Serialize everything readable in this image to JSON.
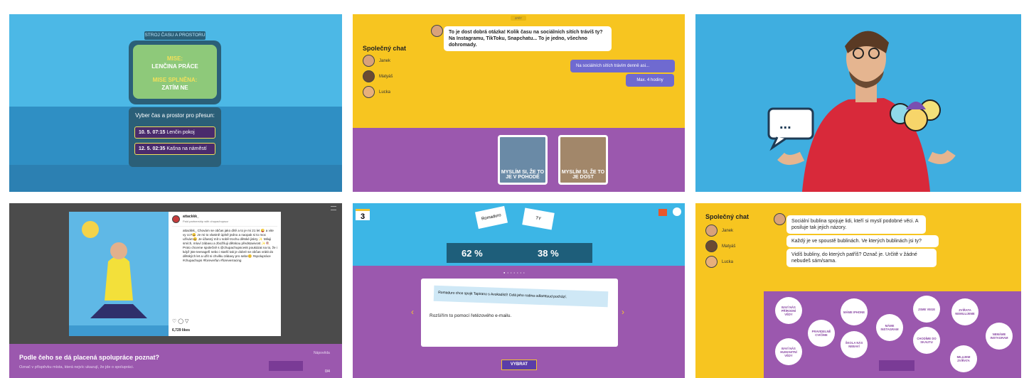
{
  "panel1": {
    "sign": "STROJ ČASU A PROSTORU",
    "mission_label": "MISE:",
    "mission_value": "LENČINA PRÁCE",
    "done_label": "MISE SPLNĚNA:",
    "done_value": "ZATÍM NE",
    "prompt": "Vyber čas a prostor pro přesun:",
    "options": [
      {
        "time": "10. 5. 07:15",
        "place": "Lenčin pokoj"
      },
      {
        "time": "12. 5. 02:35",
        "place": "Kašna na náměstí"
      }
    ]
  },
  "panel2": {
    "sidebar_title": "Společný chat",
    "people": [
      "Janek",
      "Matyáš",
      "Lucka"
    ],
    "question": "To je dost dobrá otázka! Kolik času na sociálních sítích trávíš ty? Na Instagramu, TikToku, Snapchatu... To je jedno, všechno dohromady.",
    "answer1": "Na sociálních sítích trávím denně asi...",
    "answer2": "Max. 4 hodiny",
    "meme1": "MYSLÍM SI, ŽE TO JE V POHODĚ",
    "meme2": "MYSLÍM SI, ŽE TO JE DOST",
    "top_tag": "ZPĚT"
  },
  "panel3": {
    "speech_dots": "..."
  },
  "panel4": {
    "username": "attackkk_",
    "subline": "Paid partnership with chupachupscz",
    "caption": "attackkk_ Chovám se občas jako dítě a to je mi 21 let 😜 a vite vy co?😀 Je mi to vlastně úplně jedno a naopak si to moc užívám😄 Je úžasný mít v sobě trochu dětské jiskry ✨ Miluji smích, mluví zábavu a zbožňuji dětskou představivost ✨🍭 Proto chceme společně s @chupachupscesk poukázat na to, že i když jste teenageři nebo i starší tak je dobré se občas vrátit do dětských let a užít si chvilku zábavy pro sebe😊 #spolupráce #chupachups #foreverfun #foreverracing",
    "likes": "6,729 likes",
    "title": "Podle čeho se dá placená spolupráce poznat?",
    "subtitle": "Označ v příspěvku místa, která nejvíc ukazují, že jde o spolupráci.",
    "help": "Nápověda",
    "counter": "0/4"
  },
  "panel5": {
    "level": "3",
    "card_left": "Romaduro",
    "card_right": "TY",
    "pct_left": "62 %",
    "pct_right": "38 %",
    "highlight": "Romaduro chce spojit Tapirano s Avokadistí! Celá jeho rodina odlamtuud pochází.",
    "answer": "Rozšířím to pomocí řetězového e-mailu.",
    "button": "VYBRAT"
  },
  "panel6": {
    "sidebar_title": "Společný chat",
    "people": [
      "Janek",
      "Matyáš",
      "Lucka"
    ],
    "msg1": "Sociální bublina spojuje lidi, kteří si myslí podobné věci. A posiluje tak jejich názory.",
    "msg2": "Každý je ve spoustě bublinách. Ve kterých bublinách jsi ty?",
    "msg3": "Vidíš bubliny, do kterých patříš? Označ je. Určitě v žádné nebudeš sám/sama.",
    "bubbles": [
      "BAVÍ NÁS PŘÍRODNÍ VĚDY",
      "PRAVIDELNĚ CVIČÍME",
      "MÁME IPHONE",
      "BAVÍ NÁS HUMANITNÍ VĚDY",
      "ŠKOLA NÁS NEBAVÍ",
      "MÁME INSTAGRAM",
      "JSME VEGE",
      "CHODÍME DO SKAUTU",
      "ZVÍŘATA NEMILUJEME",
      "MILUJEM ZVÍŘATA",
      "NEMÁME INSTAGRAM"
    ]
  }
}
